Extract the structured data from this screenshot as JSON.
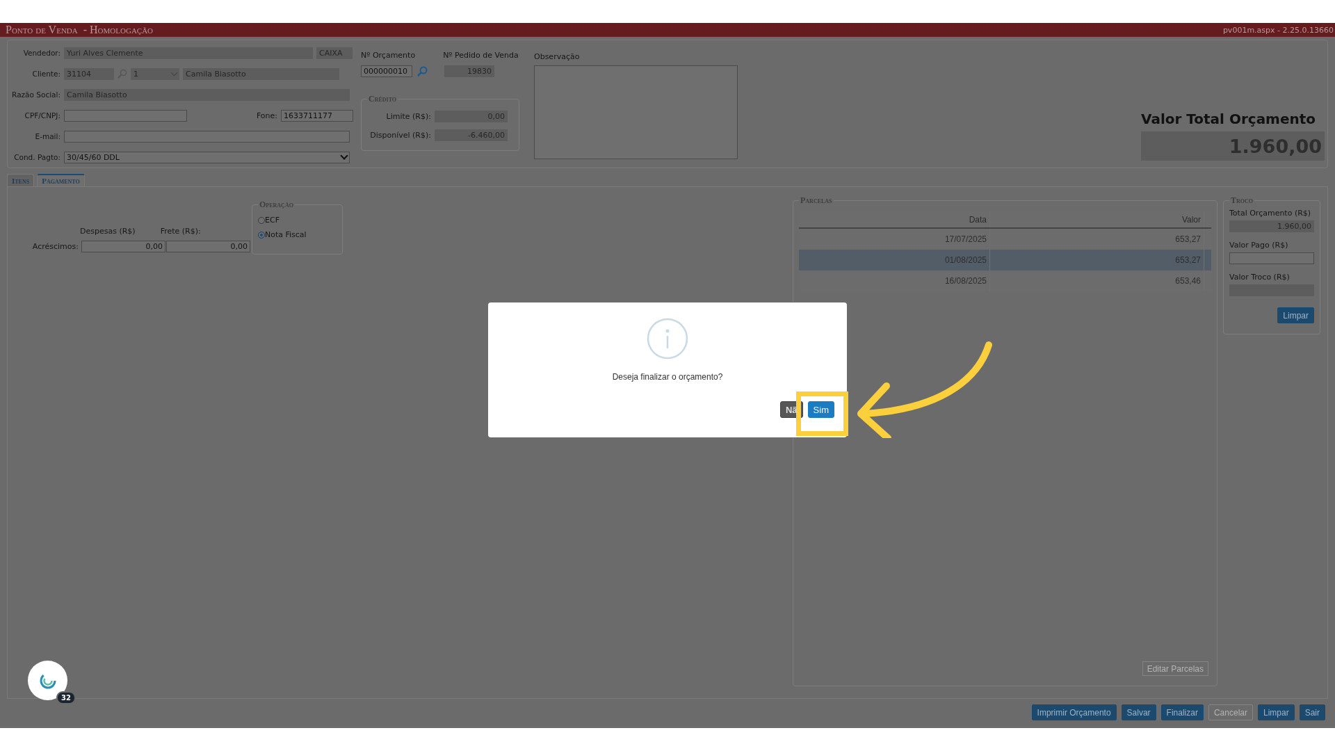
{
  "header": {
    "title": "Ponto de Venda  - Homologação",
    "version": "pv001m.aspx - 2.25.0.13660"
  },
  "form": {
    "vendedor": {
      "label": "Vendedor:",
      "value": "Yuri Alves Clemente",
      "extra": "CAIXA"
    },
    "cliente": {
      "label": "Cliente:",
      "code": "31104",
      "select": "1",
      "name": "Camila Biasotto"
    },
    "razao": {
      "label": "Razão Social:",
      "value": "Camila Biasotto"
    },
    "cpf": {
      "label": "CPF/CNPJ:",
      "fone_label": "Fone:",
      "fone": "1633711177"
    },
    "email": {
      "label": "E-mail:"
    },
    "cond": {
      "label": "Cond. Pagto:",
      "value": "30/45/60 DDL"
    },
    "orcamento": {
      "label": "Nº Orçamento",
      "value": "000000010"
    },
    "pedido": {
      "label": "Nº Pedido de Venda",
      "value": "19830"
    },
    "credito": {
      "legend": "Crédito",
      "rows": [
        {
          "label": "Limite (R$):",
          "value": "0,00"
        },
        {
          "label": "Disponível (R$):",
          "value": "-6.460,00"
        }
      ]
    },
    "observacao": {
      "label": "Observação"
    },
    "total": {
      "label": "Valor Total Orçamento",
      "value": "1.960,00"
    }
  },
  "tabs": [
    {
      "label": "Itens",
      "selected": false
    },
    {
      "label": "Pagamento",
      "selected": true
    }
  ],
  "pagamento": {
    "despesas_label": "Despesas (R$)",
    "frete_label": "Frete (R$):",
    "acrescimos_label": "Acréscimos:",
    "despesas": "0,00",
    "frete": "0,00",
    "operacao": {
      "legend": "Operação",
      "options": [
        {
          "label": "ECF",
          "selected": false
        },
        {
          "label": "Nota Fiscal",
          "selected": true
        }
      ]
    },
    "parcelas": {
      "legend": "Parcelas",
      "columns": [
        "Data",
        "Valor"
      ],
      "rows": [
        {
          "data": "17/07/2025",
          "valor": "653,27",
          "selected": false
        },
        {
          "data": "01/08/2025",
          "valor": "653,27",
          "selected": true
        },
        {
          "data": "16/08/2025",
          "valor": "653,46",
          "selected": false
        }
      ],
      "edit_button": {
        "label": "Editar Parcelas",
        "disabled": true
      }
    },
    "troco": {
      "legend": "Troco",
      "total_label": "Total Orçamento (R$)",
      "total": "1.960,00",
      "pago_label": "Valor Pago (R$)",
      "troco_label": "Valor Troco (R$)",
      "button": "Limpar"
    }
  },
  "actions": [
    {
      "label": "Imprimir Orçamento",
      "disabled": false
    },
    {
      "label": "Salvar",
      "disabled": false
    },
    {
      "label": "Finalizar",
      "disabled": false
    },
    {
      "label": "Cancelar",
      "disabled": true
    },
    {
      "label": "Limpar",
      "disabled": false
    },
    {
      "label": "Sair",
      "disabled": false
    }
  ],
  "chat": {
    "badge": "32"
  },
  "dialog": {
    "message": "Deseja finalizar o orçamento?",
    "buttons": [
      {
        "label": "Nã",
        "kind": "secondary"
      },
      {
        "label": "Sim",
        "kind": "primary"
      }
    ]
  }
}
